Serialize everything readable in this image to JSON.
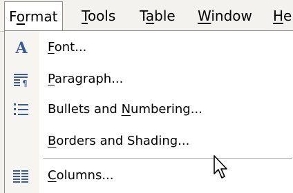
{
  "menubar": {
    "items": [
      {
        "pre": "F",
        "key": "o",
        "post": "rmat"
      },
      {
        "pre": "",
        "key": "T",
        "post": "ools"
      },
      {
        "pre": "T",
        "key": "a",
        "post": "ble"
      },
      {
        "pre": "",
        "key": "W",
        "post": "indow"
      },
      {
        "pre": "",
        "key": "H",
        "post": "el"
      }
    ]
  },
  "menu": {
    "items": [
      {
        "pre": "",
        "key": "F",
        "post": "ont...",
        "icon": "font-icon"
      },
      {
        "pre": "",
        "key": "P",
        "post": "aragraph...",
        "icon": "paragraph-icon"
      },
      {
        "pre": "Bullets and ",
        "key": "N",
        "post": "umbering...",
        "icon": "bullets-icon"
      },
      {
        "pre": "",
        "key": "B",
        "post": "orders and Shading...",
        "icon": ""
      },
      {
        "pre": "",
        "key": "C",
        "post": "olumns...",
        "icon": "columns-icon"
      }
    ]
  },
  "colors": {
    "menubar_bg": "#f3f2ee",
    "menu_bg": "#ffffff",
    "icon_blue": "#3a5a9c"
  }
}
